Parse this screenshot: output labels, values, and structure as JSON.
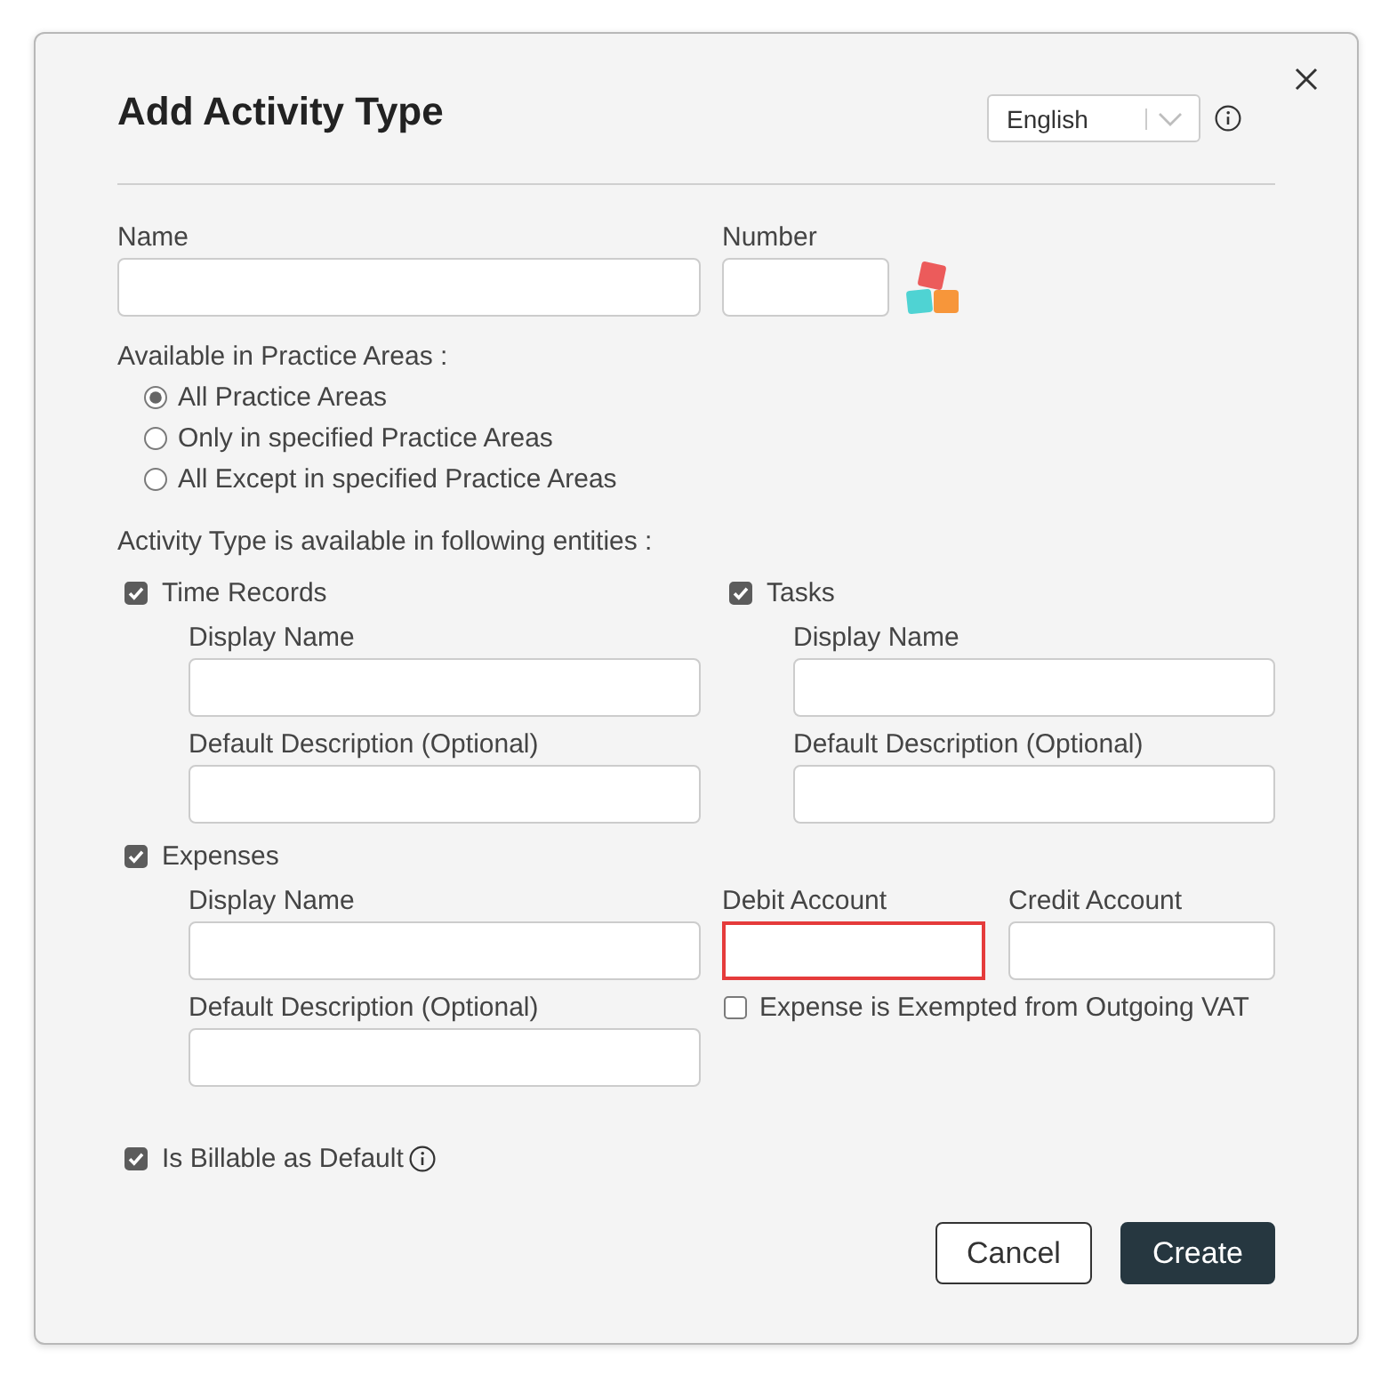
{
  "dialog": {
    "title": "Add Activity Type",
    "language": {
      "value": "English"
    }
  },
  "name_field": {
    "label": "Name"
  },
  "number_field": {
    "label": "Number"
  },
  "practice_areas": {
    "label": "Available in Practice Areas :",
    "options": [
      {
        "label": "All Practice Areas",
        "selected": true
      },
      {
        "label": "Only in specified Practice Areas",
        "selected": false
      },
      {
        "label": "All Except in specified Practice Areas",
        "selected": false
      }
    ]
  },
  "entities": {
    "label": "Activity Type is available in following entities :",
    "groups": [
      {
        "kind": "simple",
        "label": "Time Records",
        "checked": true,
        "fields": [
          {
            "label": "Display Name"
          },
          {
            "label": "Default Description (Optional)"
          }
        ]
      },
      {
        "kind": "simple",
        "label": "Tasks",
        "checked": true,
        "fields": [
          {
            "label": "Display Name"
          },
          {
            "label": "Default Description (Optional)"
          }
        ]
      },
      {
        "kind": "accounts",
        "label": "Expenses",
        "checked": true,
        "fields": [
          {
            "label": "Display Name"
          },
          {
            "label": "Default Description (Optional)"
          }
        ],
        "accounts": [
          {
            "label": "Debit Account",
            "invalid": true
          },
          {
            "label": "Credit Account",
            "invalid": false
          }
        ],
        "exempt_vat": {
          "label": "Expense is Exempted from Outgoing VAT",
          "checked": false
        }
      }
    ]
  },
  "billable": {
    "label": "Is Billable as Default",
    "checked": true
  },
  "buttons": [
    {
      "label": "Cancel",
      "kind": "secondary"
    },
    {
      "label": "Create",
      "kind": "primary"
    }
  ]
}
